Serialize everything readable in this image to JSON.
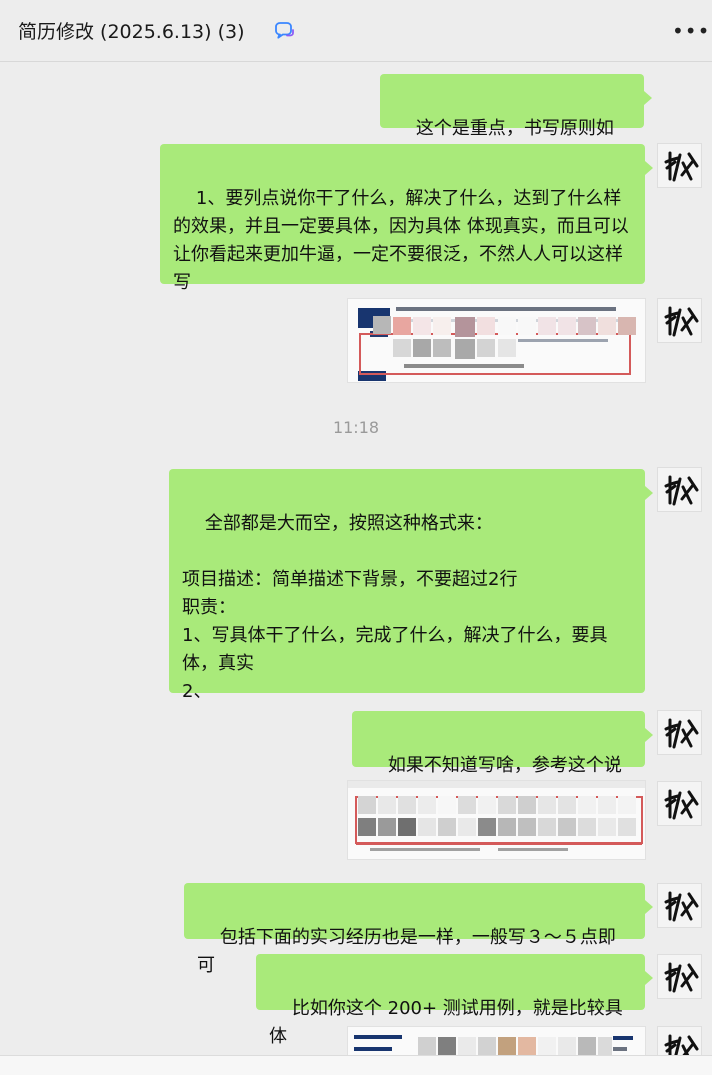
{
  "header": {
    "title": "简历修改 (2025.6.13)",
    "count": "(3)",
    "chat_icon": "chat-bubble-icon",
    "more_icon": "more-horizontal-icon"
  },
  "messages": [
    {
      "type": "text",
      "text": "这个是重点，书写原则如下："
    },
    {
      "type": "text",
      "text": "1、要列点说你干了什么，解决了什么，达到了什么样的效果，并且一定要具体，因为具体 体现真实，而且可以让你看起来更加牛逼，一定不要很泛，不然人人可以这样写"
    },
    {
      "type": "image"
    },
    {
      "type": "time",
      "text": "11:18"
    },
    {
      "type": "text",
      "text": "全部都是大而空，按照这种格式来：\n\n项目描述：简单描述下背景，不要超过2行\n职责：\n1、写具体干了什么，完成了什么，解决了什么，要具体，真实\n2、"
    },
    {
      "type": "text",
      "text": "如果不知道写啥，参考这个说明"
    },
    {
      "type": "image"
    },
    {
      "type": "text",
      "text": "包括下面的实习经历也是一样，一般写３～５点即可"
    },
    {
      "type": "text",
      "text": "比如你这个 200+ 测试用例，就是比较具体"
    },
    {
      "type": "image"
    }
  ],
  "colors": {
    "bubble": "#a9ea7a",
    "background": "#ededed",
    "time": "#9a9a9a"
  }
}
